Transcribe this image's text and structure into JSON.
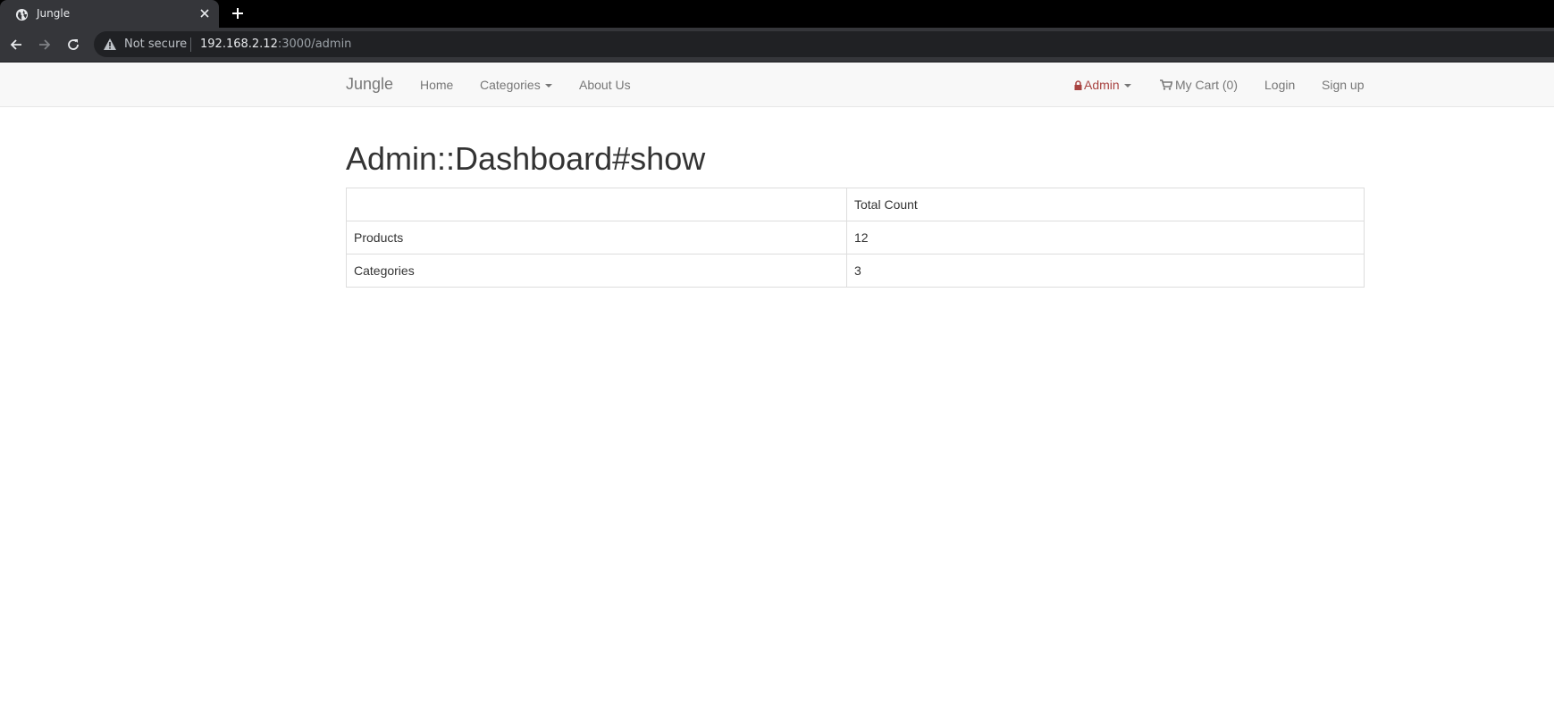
{
  "browser": {
    "tab_title": "Jungle",
    "security_label": "Not secure",
    "url_host": "192.168.2.12",
    "url_rest": ":3000/admin"
  },
  "navbar": {
    "brand": "Jungle",
    "left_items": [
      "Home",
      "Categories",
      "About Us"
    ],
    "admin_label": "Admin",
    "cart_label": "My Cart (0)",
    "login_label": "Login",
    "signup_label": "Sign up",
    "admin_color": "#a94442"
  },
  "main": {
    "title": "Admin::Dashboard#show",
    "table": {
      "header": [
        "",
        "Total Count"
      ],
      "rows": [
        [
          "Products",
          "12"
        ],
        [
          "Categories",
          "3"
        ]
      ]
    }
  },
  "icons": [
    "globe-icon",
    "close-icon",
    "plus-icon",
    "back-arrow-icon",
    "forward-arrow-icon",
    "reload-icon",
    "warning-icon",
    "lock-icon",
    "cart-icon",
    "caret-down-icon"
  ]
}
